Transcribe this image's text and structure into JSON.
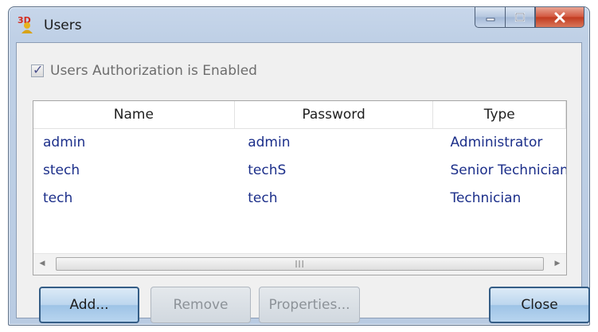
{
  "window": {
    "title": "Users",
    "icon": "3d-app-icon",
    "controls": [
      "minimize-icon",
      "maximize-icon",
      "close-icon"
    ]
  },
  "auth": {
    "label": "Users Authorization is Enabled",
    "checked": true
  },
  "table": {
    "columns": [
      "Name",
      "Password",
      "Type"
    ],
    "rows": [
      {
        "name": "admin",
        "password": "admin",
        "type": "Administrator"
      },
      {
        "name": "stech",
        "password": "techS",
        "type": "Senior Technician"
      },
      {
        "name": "tech",
        "password": "tech",
        "type": "Technician"
      }
    ]
  },
  "buttons": {
    "add": "Add...",
    "remove": "Remove",
    "properties": "Properties...",
    "close": "Close"
  },
  "colors": {
    "row_text": "#1c2f8a",
    "close_button": "#c8452a"
  }
}
